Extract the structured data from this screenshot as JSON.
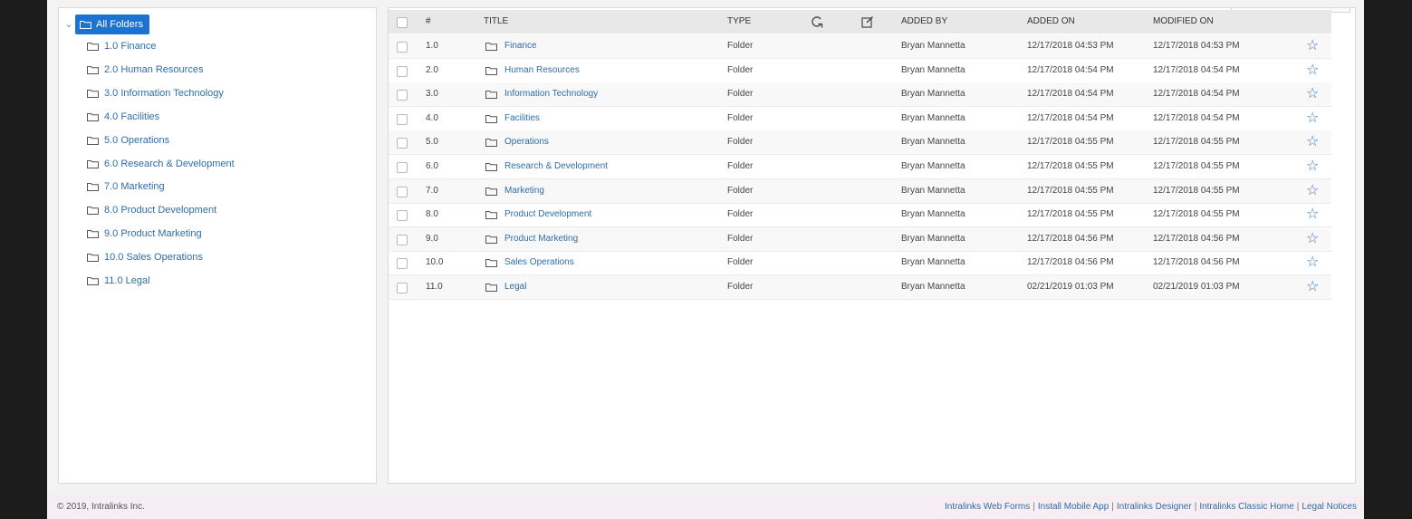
{
  "tree": {
    "root_label": "All Folders",
    "items": [
      "1.0 Finance",
      "2.0 Human Resources",
      "3.0 Information Technology",
      "4.0 Facilities",
      "5.0 Operations",
      "6.0 Research & Development",
      "7.0 Marketing",
      "8.0 Product Development",
      "9.0 Product Marketing",
      "10.0 Sales Operations",
      "11.0 Legal"
    ]
  },
  "grid": {
    "headers": {
      "number": "#",
      "title": "TITLE",
      "type": "TYPE",
      "added_by": "ADDED BY",
      "added_on": "ADDED ON",
      "modified_on": "MODIFIED ON"
    },
    "rows": [
      {
        "num": "1.0",
        "title": "Finance",
        "type": "Folder",
        "added_by": "Bryan Mannetta",
        "added_on": "12/17/2018 04:53 PM",
        "modified_on": "12/17/2018 04:53 PM"
      },
      {
        "num": "2.0",
        "title": "Human Resources",
        "type": "Folder",
        "added_by": "Bryan Mannetta",
        "added_on": "12/17/2018 04:54 PM",
        "modified_on": "12/17/2018 04:54 PM"
      },
      {
        "num": "3.0",
        "title": "Information Technology",
        "type": "Folder",
        "added_by": "Bryan Mannetta",
        "added_on": "12/17/2018 04:54 PM",
        "modified_on": "12/17/2018 04:54 PM"
      },
      {
        "num": "4.0",
        "title": "Facilities",
        "type": "Folder",
        "added_by": "Bryan Mannetta",
        "added_on": "12/17/2018 04:54 PM",
        "modified_on": "12/17/2018 04:54 PM"
      },
      {
        "num": "5.0",
        "title": "Operations",
        "type": "Folder",
        "added_by": "Bryan Mannetta",
        "added_on": "12/17/2018 04:55 PM",
        "modified_on": "12/17/2018 04:55 PM"
      },
      {
        "num": "6.0",
        "title": "Research & Development",
        "type": "Folder",
        "added_by": "Bryan Mannetta",
        "added_on": "12/17/2018 04:55 PM",
        "modified_on": "12/17/2018 04:55 PM"
      },
      {
        "num": "7.0",
        "title": "Marketing",
        "type": "Folder",
        "added_by": "Bryan Mannetta",
        "added_on": "12/17/2018 04:55 PM",
        "modified_on": "12/17/2018 04:55 PM"
      },
      {
        "num": "8.0",
        "title": "Product Development",
        "type": "Folder",
        "added_by": "Bryan Mannetta",
        "added_on": "12/17/2018 04:55 PM",
        "modified_on": "12/17/2018 04:55 PM"
      },
      {
        "num": "9.0",
        "title": "Product Marketing",
        "type": "Folder",
        "added_by": "Bryan Mannetta",
        "added_on": "12/17/2018 04:56 PM",
        "modified_on": "12/17/2018 04:56 PM"
      },
      {
        "num": "10.0",
        "title": "Sales Operations",
        "type": "Folder",
        "added_by": "Bryan Mannetta",
        "added_on": "12/17/2018 04:56 PM",
        "modified_on": "12/17/2018 04:56 PM"
      },
      {
        "num": "11.0",
        "title": "Legal",
        "type": "Folder",
        "added_by": "Bryan Mannetta",
        "added_on": "02/21/2019 01:03 PM",
        "modified_on": "02/21/2019 01:03 PM"
      }
    ]
  },
  "footer": {
    "copyright": "© 2019, Intralinks Inc.",
    "links": [
      "Intralinks Web Forms",
      "Install Mobile App",
      "Intralinks Designer",
      "Intralinks Classic Home",
      "Legal Notices"
    ],
    "separator": "|"
  },
  "icons": {
    "folder": "folder-icon",
    "star": "star-icon",
    "refresh": "refresh-icon",
    "edit": "edit-icon"
  },
  "colors": {
    "accent": "#1d73d2",
    "link": "#2e6da8",
    "star": "#2f78c4"
  }
}
